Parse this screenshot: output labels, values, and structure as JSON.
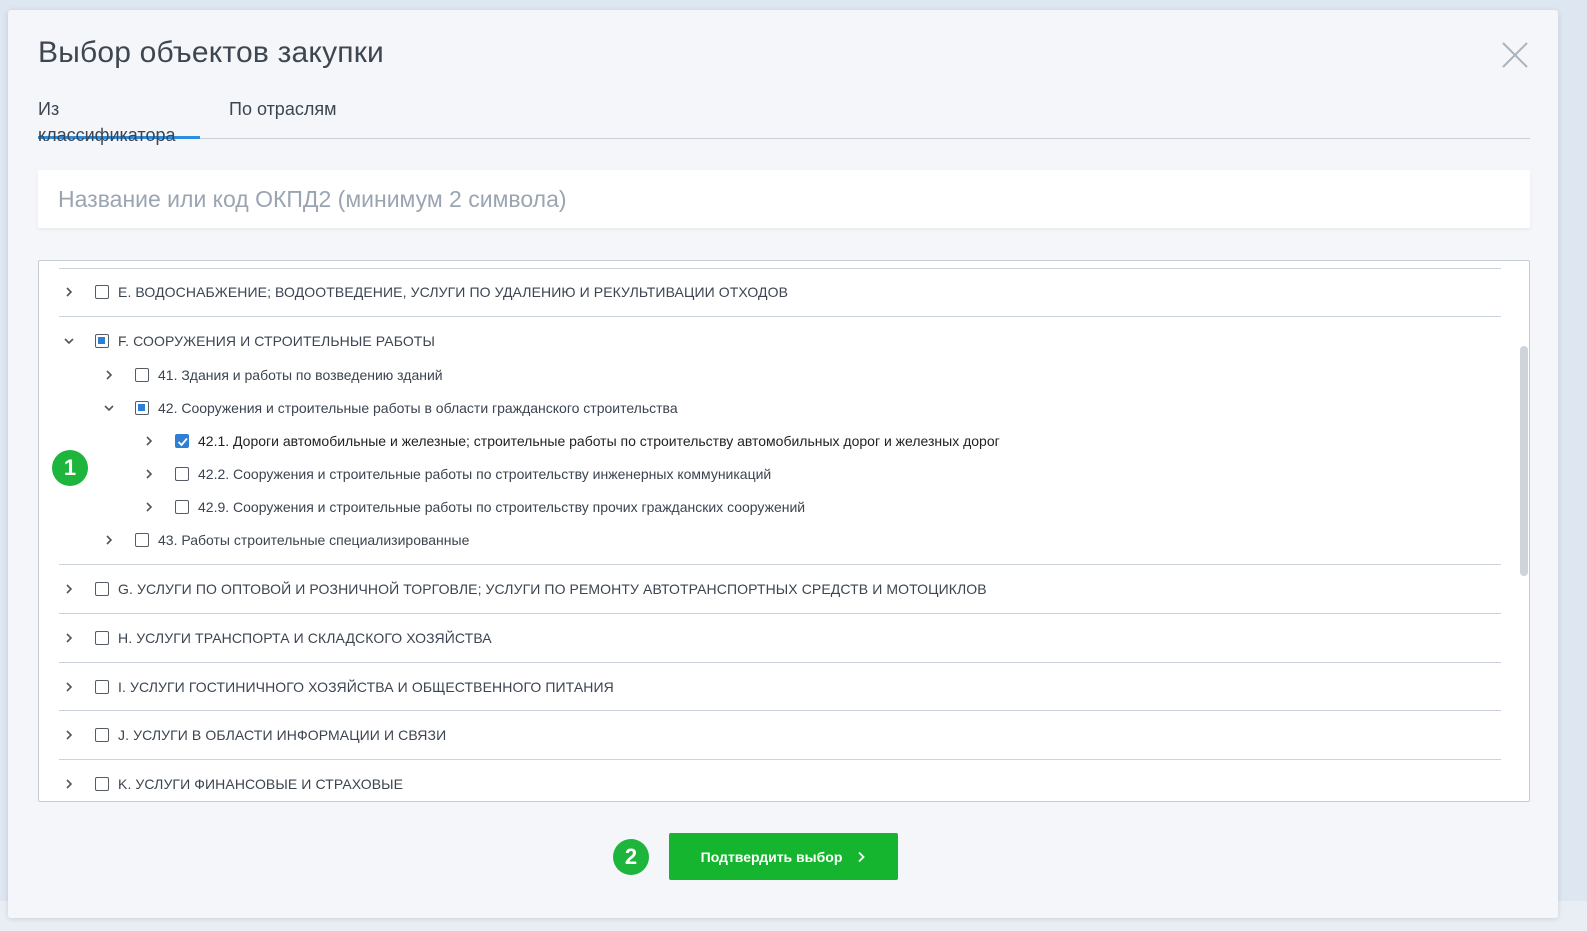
{
  "modal": {
    "title": "Выбор объектов закупки",
    "tabs": [
      {
        "label": "Из классификатора",
        "active": true
      },
      {
        "label": "По отраслям",
        "active": false
      }
    ],
    "search": {
      "placeholder": "Название или код ОКПД2 (минимум 2 символа)",
      "value": ""
    },
    "tree": {
      "items": [
        {
          "label": "E. ВОДОСНАБЖЕНИЕ; ВОДООТВЕДЕНИЕ, УСЛУГИ ПО УДАЛЕНИЮ И РЕКУЛЬТИВАЦИИ ОТХОДОВ",
          "state": "unchecked",
          "expanded": false
        },
        {
          "label": "F. СООРУЖЕНИЯ И СТРОИТЕЛЬНЫЕ РАБОТЫ",
          "state": "partial",
          "expanded": true,
          "children": [
            {
              "label": "41. Здания и работы по возведению зданий",
              "state": "unchecked",
              "expanded": false
            },
            {
              "label": "42. Сооружения и строительные работы в области гражданского строительства",
              "state": "partial",
              "expanded": true,
              "children": [
                {
                  "label": "42.1. Дороги автомобильные и железные; строительные работы по строительству автомобильных дорог и железных дорог",
                  "state": "checked"
                },
                {
                  "label": "42.2. Сооружения и строительные работы по строительству инженерных коммуникаций",
                  "state": "unchecked"
                },
                {
                  "label": "42.9. Сооружения и строительные работы по строительству прочих гражданских сооружений",
                  "state": "unchecked"
                }
              ]
            },
            {
              "label": "43. Работы строительные специализированные",
              "state": "unchecked",
              "expanded": false
            }
          ]
        },
        {
          "label": "G. УСЛУГИ ПО ОПТОВОЙ И РОЗНИЧНОЙ ТОРГОВЛЕ; УСЛУГИ ПО РЕМОНТУ АВТОТРАНСПОРТНЫХ СРЕДСТВ И МОТОЦИКЛОВ",
          "state": "unchecked",
          "expanded": false
        },
        {
          "label": "H. УСЛУГИ ТРАНСПОРТА И СКЛАДСКОГО ХОЗЯЙСТВА",
          "state": "unchecked",
          "expanded": false
        },
        {
          "label": "I. УСЛУГИ ГОСТИНИЧНОГО ХОЗЯЙСТВА И ОБЩЕСТВЕННОГО ПИТАНИЯ",
          "state": "unchecked",
          "expanded": false
        },
        {
          "label": "J. УСЛУГИ В ОБЛАСТИ ИНФОРМАЦИИ И СВЯЗИ",
          "state": "unchecked",
          "expanded": false
        },
        {
          "label": "K. УСЛУГИ ФИНАНСОВЫЕ И СТРАХОВЫЕ",
          "state": "unchecked",
          "expanded": false
        }
      ]
    },
    "confirm_label": "Подтвердить выбор"
  },
  "annotations": {
    "badge1": "1",
    "badge2": "2"
  },
  "colors": {
    "accent": "#2d7fd6",
    "confirm": "#16b530",
    "badge": "#1db53b"
  },
  "icons": {
    "close": "close-icon",
    "chevron_right": "chevron-right-icon",
    "chevron_down": "chevron-down-icon",
    "check": "check-icon"
  }
}
